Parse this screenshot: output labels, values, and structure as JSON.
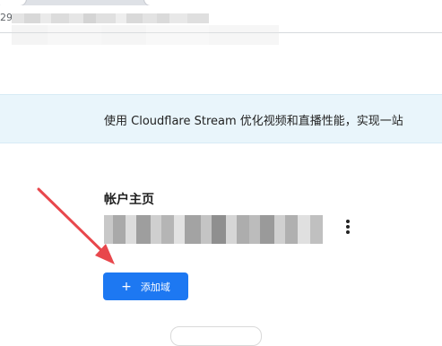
{
  "browser": {
    "url_prefix": "29"
  },
  "banner": {
    "text": "使用 Cloudflare Stream 优化视频和直播性能，实现一站"
  },
  "account": {
    "title": "帐户主页"
  },
  "actions": {
    "add_domain_label": "添加域",
    "add_icon": "+"
  },
  "icons": {
    "more": "more-vertical-icon",
    "arrow": "annotation-arrow-icon"
  },
  "colors": {
    "banner_bg": "#e9f5fb",
    "primary_button": "#1d78f2",
    "annotation_arrow": "#e8474c"
  }
}
